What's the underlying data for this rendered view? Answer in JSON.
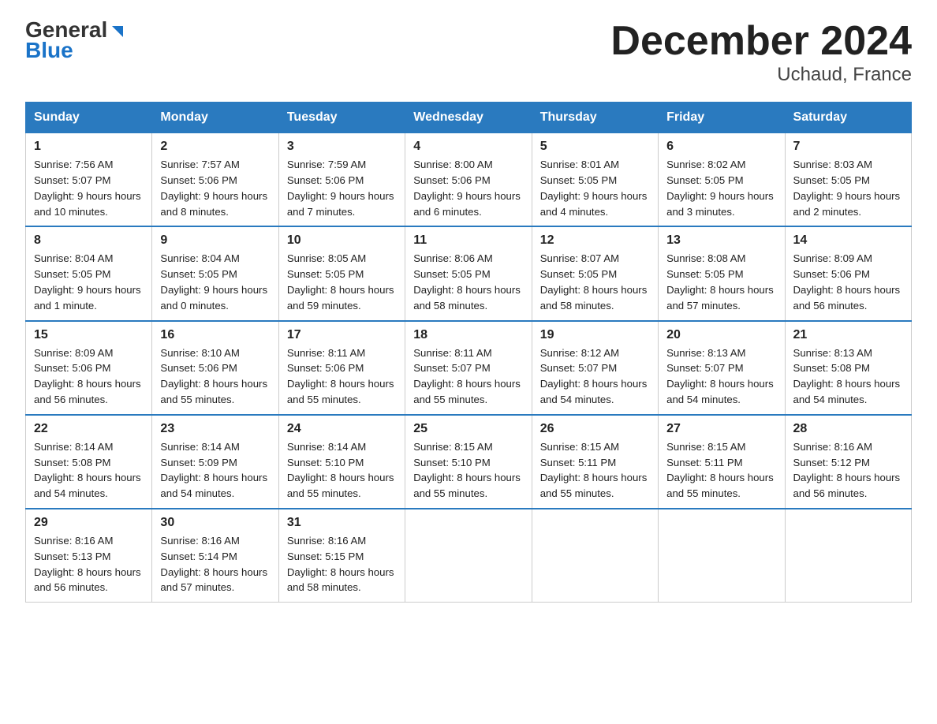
{
  "header": {
    "logo_line1": "General",
    "logo_line2": "Blue",
    "title": "December 2024",
    "subtitle": "Uchaud, France"
  },
  "days_of_week": [
    "Sunday",
    "Monday",
    "Tuesday",
    "Wednesday",
    "Thursday",
    "Friday",
    "Saturday"
  ],
  "weeks": [
    [
      {
        "day": "1",
        "sunrise": "7:56 AM",
        "sunset": "5:07 PM",
        "daylight": "9 hours and 10 minutes."
      },
      {
        "day": "2",
        "sunrise": "7:57 AM",
        "sunset": "5:06 PM",
        "daylight": "9 hours and 8 minutes."
      },
      {
        "day": "3",
        "sunrise": "7:59 AM",
        "sunset": "5:06 PM",
        "daylight": "9 hours and 7 minutes."
      },
      {
        "day": "4",
        "sunrise": "8:00 AM",
        "sunset": "5:06 PM",
        "daylight": "9 hours and 6 minutes."
      },
      {
        "day": "5",
        "sunrise": "8:01 AM",
        "sunset": "5:05 PM",
        "daylight": "9 hours and 4 minutes."
      },
      {
        "day": "6",
        "sunrise": "8:02 AM",
        "sunset": "5:05 PM",
        "daylight": "9 hours and 3 minutes."
      },
      {
        "day": "7",
        "sunrise": "8:03 AM",
        "sunset": "5:05 PM",
        "daylight": "9 hours and 2 minutes."
      }
    ],
    [
      {
        "day": "8",
        "sunrise": "8:04 AM",
        "sunset": "5:05 PM",
        "daylight": "9 hours and 1 minute."
      },
      {
        "day": "9",
        "sunrise": "8:04 AM",
        "sunset": "5:05 PM",
        "daylight": "9 hours and 0 minutes."
      },
      {
        "day": "10",
        "sunrise": "8:05 AM",
        "sunset": "5:05 PM",
        "daylight": "8 hours and 59 minutes."
      },
      {
        "day": "11",
        "sunrise": "8:06 AM",
        "sunset": "5:05 PM",
        "daylight": "8 hours and 58 minutes."
      },
      {
        "day": "12",
        "sunrise": "8:07 AM",
        "sunset": "5:05 PM",
        "daylight": "8 hours and 58 minutes."
      },
      {
        "day": "13",
        "sunrise": "8:08 AM",
        "sunset": "5:05 PM",
        "daylight": "8 hours and 57 minutes."
      },
      {
        "day": "14",
        "sunrise": "8:09 AM",
        "sunset": "5:06 PM",
        "daylight": "8 hours and 56 minutes."
      }
    ],
    [
      {
        "day": "15",
        "sunrise": "8:09 AM",
        "sunset": "5:06 PM",
        "daylight": "8 hours and 56 minutes."
      },
      {
        "day": "16",
        "sunrise": "8:10 AM",
        "sunset": "5:06 PM",
        "daylight": "8 hours and 55 minutes."
      },
      {
        "day": "17",
        "sunrise": "8:11 AM",
        "sunset": "5:06 PM",
        "daylight": "8 hours and 55 minutes."
      },
      {
        "day": "18",
        "sunrise": "8:11 AM",
        "sunset": "5:07 PM",
        "daylight": "8 hours and 55 minutes."
      },
      {
        "day": "19",
        "sunrise": "8:12 AM",
        "sunset": "5:07 PM",
        "daylight": "8 hours and 54 minutes."
      },
      {
        "day": "20",
        "sunrise": "8:13 AM",
        "sunset": "5:07 PM",
        "daylight": "8 hours and 54 minutes."
      },
      {
        "day": "21",
        "sunrise": "8:13 AM",
        "sunset": "5:08 PM",
        "daylight": "8 hours and 54 minutes."
      }
    ],
    [
      {
        "day": "22",
        "sunrise": "8:14 AM",
        "sunset": "5:08 PM",
        "daylight": "8 hours and 54 minutes."
      },
      {
        "day": "23",
        "sunrise": "8:14 AM",
        "sunset": "5:09 PM",
        "daylight": "8 hours and 54 minutes."
      },
      {
        "day": "24",
        "sunrise": "8:14 AM",
        "sunset": "5:10 PM",
        "daylight": "8 hours and 55 minutes."
      },
      {
        "day": "25",
        "sunrise": "8:15 AM",
        "sunset": "5:10 PM",
        "daylight": "8 hours and 55 minutes."
      },
      {
        "day": "26",
        "sunrise": "8:15 AM",
        "sunset": "5:11 PM",
        "daylight": "8 hours and 55 minutes."
      },
      {
        "day": "27",
        "sunrise": "8:15 AM",
        "sunset": "5:11 PM",
        "daylight": "8 hours and 55 minutes."
      },
      {
        "day": "28",
        "sunrise": "8:16 AM",
        "sunset": "5:12 PM",
        "daylight": "8 hours and 56 minutes."
      }
    ],
    [
      {
        "day": "29",
        "sunrise": "8:16 AM",
        "sunset": "5:13 PM",
        "daylight": "8 hours and 56 minutes."
      },
      {
        "day": "30",
        "sunrise": "8:16 AM",
        "sunset": "5:14 PM",
        "daylight": "8 hours and 57 minutes."
      },
      {
        "day": "31",
        "sunrise": "8:16 AM",
        "sunset": "5:15 PM",
        "daylight": "8 hours and 58 minutes."
      },
      null,
      null,
      null,
      null
    ]
  ]
}
